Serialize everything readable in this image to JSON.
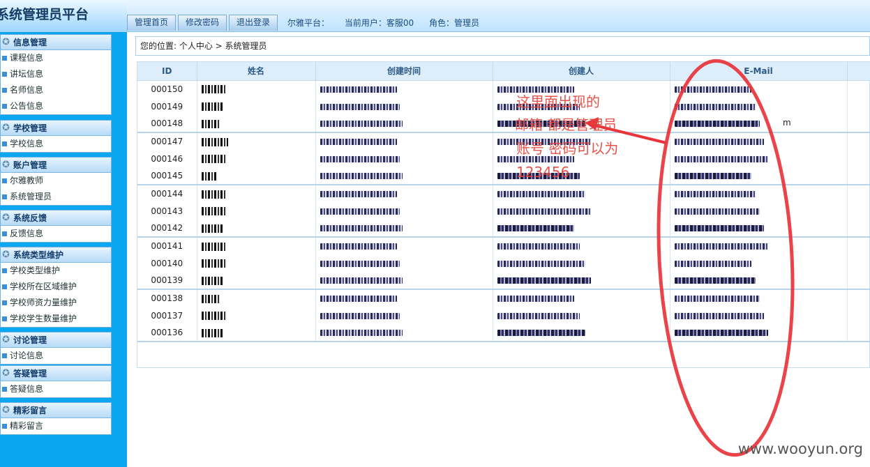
{
  "app": {
    "title": "系统管理员平台"
  },
  "toolbar": {
    "buttons": [
      "管理首页",
      "修改密码",
      "退出登录"
    ],
    "platform": "尔雅平台：",
    "current_user": "当前用户：客服00",
    "role": "角色：管理员"
  },
  "sidebar": {
    "groups": [
      {
        "title": "信息管理",
        "items": [
          "课程信息",
          "讲坛信息",
          "名师信息",
          "公告信息"
        ]
      },
      {
        "title": "学校管理",
        "items": [
          "学校信息"
        ]
      },
      {
        "title": "账户管理",
        "items": [
          "尔雅教师",
          "系统管理员"
        ]
      },
      {
        "title": "系统反馈",
        "items": [
          "反馈信息"
        ]
      },
      {
        "title": "系统类型维护",
        "items": [
          "学校类型维护",
          "学校所在区域维护",
          "学校师资力量维护",
          "学校学生数量维护"
        ]
      },
      {
        "title": "讨论管理",
        "items": [
          "讨论信息"
        ]
      },
      {
        "title": "答疑管理",
        "items": [
          "答疑信息"
        ]
      },
      {
        "title": "精彩留言",
        "items": [
          "精彩留言"
        ]
      }
    ]
  },
  "breadcrumb": {
    "text": "您的位置: 个人中心 > 系统管理员"
  },
  "table": {
    "columns": [
      "ID",
      "姓名",
      "创建时间",
      "创建人",
      "E-Mail"
    ],
    "rows": [
      {
        "id": "000150"
      },
      {
        "id": "000149"
      },
      {
        "id": "000148"
      },
      {
        "id": "000147"
      },
      {
        "id": "000146"
      },
      {
        "id": "000145"
      },
      {
        "id": "000144"
      },
      {
        "id": "000143"
      },
      {
        "id": "000142"
      },
      {
        "id": "000141"
      },
      {
        "id": "000140"
      },
      {
        "id": "000139"
      },
      {
        "id": "000138"
      },
      {
        "id": "000137"
      },
      {
        "id": "000136"
      }
    ]
  },
  "annotation": {
    "lines": [
      "这里面出现的",
      "邮箱 都是管理员",
      "账号 密码可以为",
      "123456"
    ],
    "email_fragment": "m"
  },
  "watermark": "www.wooyun.org"
}
